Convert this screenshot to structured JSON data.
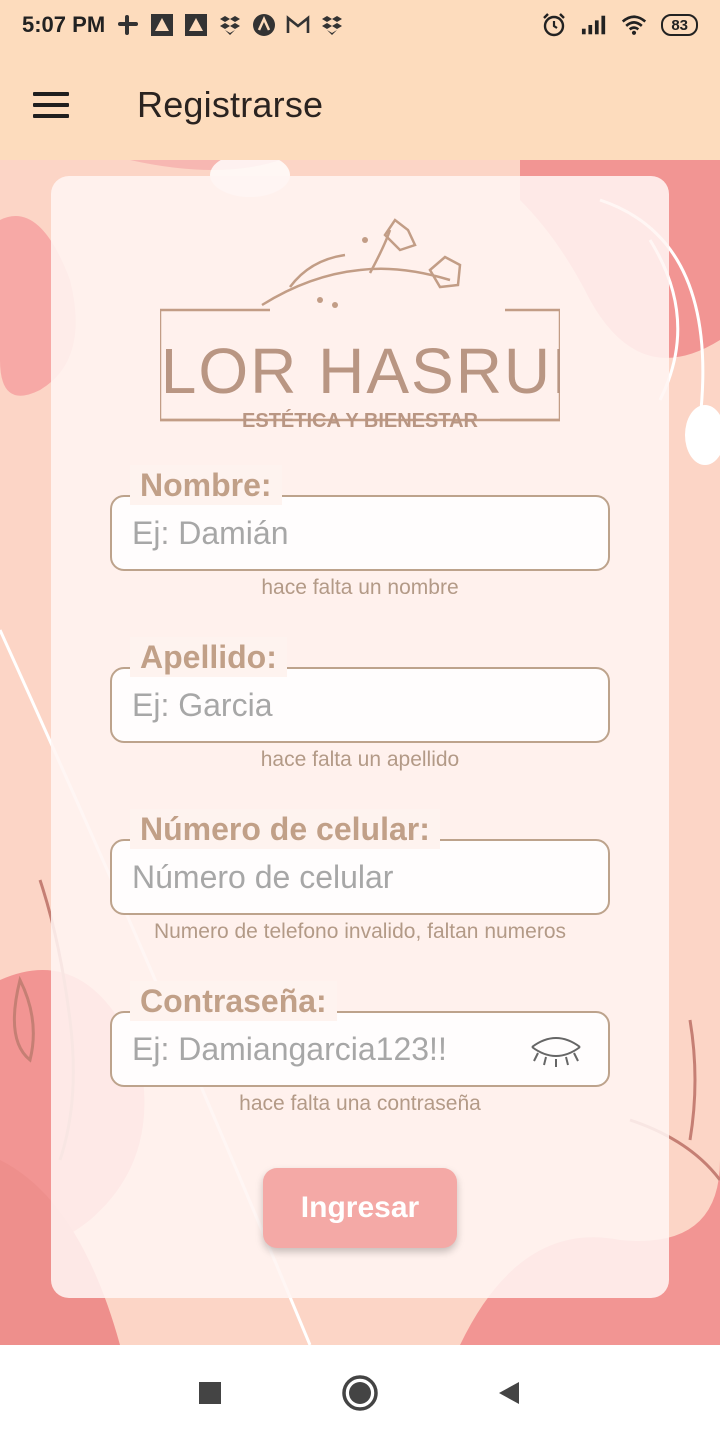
{
  "status_bar": {
    "time": "5:07 PM",
    "battery": "83",
    "left_icons": [
      "slack-icon",
      "app-icon",
      "app-icon",
      "dropbox-icon",
      "arc-icon",
      "gmail-icon",
      "dropbox-icon"
    ],
    "right_icons": [
      "alarm-icon",
      "signal-icon",
      "wifi-icon"
    ]
  },
  "app_bar": {
    "title": "Registrarse",
    "menu_icon": "hamburger-menu-icon"
  },
  "logo": {
    "brand": "FLOR HASRUN",
    "tagline": "ESTÉTICA Y BIENESTAR"
  },
  "form": {
    "nombre": {
      "label": "Nombre:",
      "placeholder": "Ej: Damián",
      "helper": "hace falta un nombre"
    },
    "apellido": {
      "label": "Apellido:",
      "placeholder": "Ej: Garcia",
      "helper": "hace falta un apellido"
    },
    "celular": {
      "label": "Número de celular:",
      "placeholder": "Número de celular",
      "helper": "Numero de telefono invalido, faltan numeros"
    },
    "contrasena": {
      "label": "Contraseña:",
      "placeholder": "Ej: Damiangarcia123!!",
      "helper": "hace falta una contraseña",
      "toggle_icon": "eye-closed-icon"
    },
    "submit_label": "Ingresar"
  },
  "nav_bar": {
    "icons": [
      "recents-square-icon",
      "home-circle-icon",
      "back-triangle-icon"
    ]
  },
  "colors": {
    "accent": "#f4a9a6",
    "label": "#c1a088",
    "app_bar": "#fddcbd",
    "border": "#bda38c"
  }
}
